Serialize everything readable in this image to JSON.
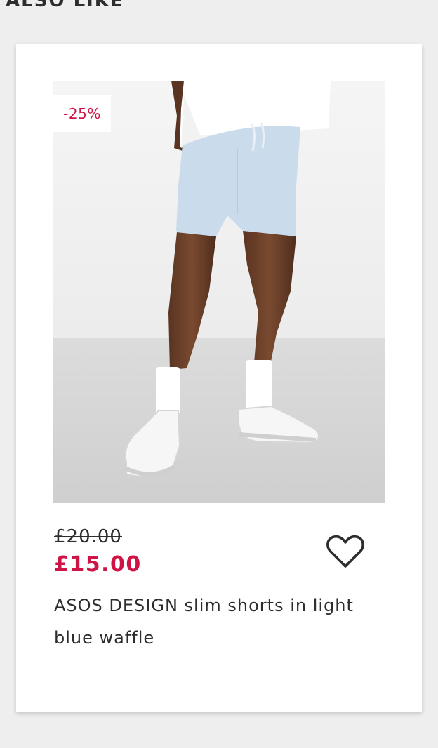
{
  "section": {
    "heading": "ALSO LIKE"
  },
  "product": {
    "discount_badge": "-25%",
    "price_was": "£20.00",
    "price_now": "£15.00",
    "title": "ASOS DESIGN slim shorts in light blue waffle",
    "save_icon": "heart-outline-icon"
  },
  "colors": {
    "sale_red": "#d01345",
    "text_dark": "#2d2d2d",
    "page_bg": "#eeeeee",
    "card_bg": "#ffffff"
  }
}
